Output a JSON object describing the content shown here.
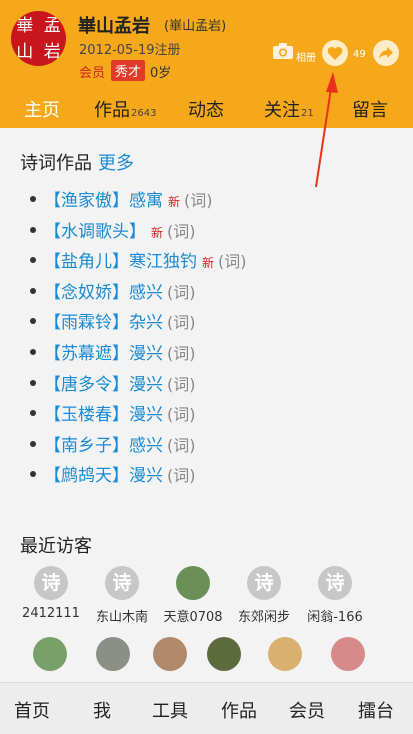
{
  "profile": {
    "name": "崋山孟岩",
    "alias": "(崋山孟岩)",
    "registered": "2012-05-19注册",
    "member_label": "会员",
    "rank": "秀才",
    "age": "0岁",
    "seal_chars": [
      "孟",
      "崋",
      "岩",
      "山"
    ],
    "album_label": "相册",
    "likes": "49"
  },
  "tabs": [
    {
      "label": "主页",
      "count": ""
    },
    {
      "label": "作品",
      "count": "2643"
    },
    {
      "label": "动态",
      "count": ""
    },
    {
      "label": "关注",
      "count": "21"
    },
    {
      "label": "留言",
      "count": ""
    }
  ],
  "poems_section": {
    "title": "诗词作品",
    "more": "更多"
  },
  "poems": [
    {
      "title": "【渔家傲】感寓",
      "new": "新",
      "kind": "(词)"
    },
    {
      "title": "【水调歌头】",
      "new": "新",
      "kind": "(词)"
    },
    {
      "title": "【盐角儿】寒江独钓",
      "new": "新",
      "kind": "(词)"
    },
    {
      "title": "【念奴娇】感兴",
      "new": "",
      "kind": "(词)"
    },
    {
      "title": "【雨霖铃】杂兴",
      "new": "",
      "kind": "(词)"
    },
    {
      "title": "【苏幕遮】漫兴",
      "new": "",
      "kind": "(词)"
    },
    {
      "title": "【唐多令】漫兴",
      "new": "",
      "kind": "(词)"
    },
    {
      "title": "【玉楼春】漫兴",
      "new": "",
      "kind": "(词)"
    },
    {
      "title": "【南乡子】感兴",
      "new": "",
      "kind": "(词)"
    },
    {
      "title": "【鹧鸪天】漫兴",
      "new": "",
      "kind": "(词)"
    }
  ],
  "visitors_section": {
    "title": "最近访客"
  },
  "visitors_row1": [
    {
      "name": "2412111",
      "avatar": "诗"
    },
    {
      "name": "东山木南",
      "avatar": "诗"
    },
    {
      "name": "天意0708",
      "avatar": ""
    },
    {
      "name": "东郊闲步",
      "avatar": "诗"
    },
    {
      "name": "闲翁-166",
      "avatar": "诗"
    }
  ],
  "bottom_nav": [
    "首页",
    "我",
    "工具",
    "作品",
    "会员",
    "擂台"
  ],
  "colors": {
    "header": "#f5a81a",
    "link": "#1b8bd4",
    "new": "#d42020",
    "seal": "#c9161c"
  }
}
